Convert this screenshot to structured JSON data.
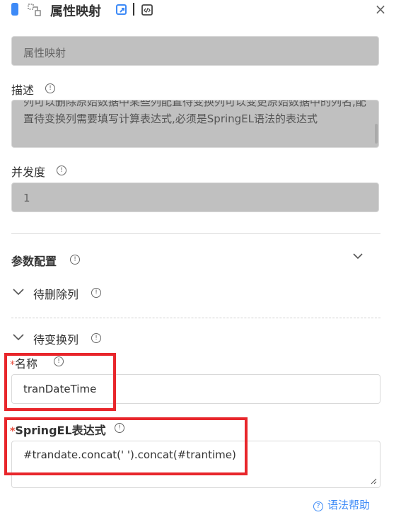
{
  "header": {
    "title": "属性映射",
    "close_glyph": "×",
    "accent_color": "#3d8af7"
  },
  "form": {
    "name_value": "属性映射",
    "desc_label": "描述",
    "desc_value": "列可以删除原始数据中某些列配置待变换列可以变更原始数据中的列名,配置待变换列需要填写计算表达式,必须是SpringEL语法的表达式",
    "concurrency_label": "并发度",
    "concurrency_value": "1"
  },
  "params": {
    "label": "参数配置",
    "sections": [
      {
        "label": "待删除列"
      },
      {
        "label": "待变换列"
      }
    ],
    "name_label": "名称",
    "name_value": "tranDateTime",
    "spel_label": "SpringEL表达式",
    "spel_value": "#trandate.concat(' ').concat(#trantime)",
    "required_mark": "*"
  },
  "footer": {
    "help_label": "语法帮助"
  },
  "annotation_color": "#e8262b"
}
